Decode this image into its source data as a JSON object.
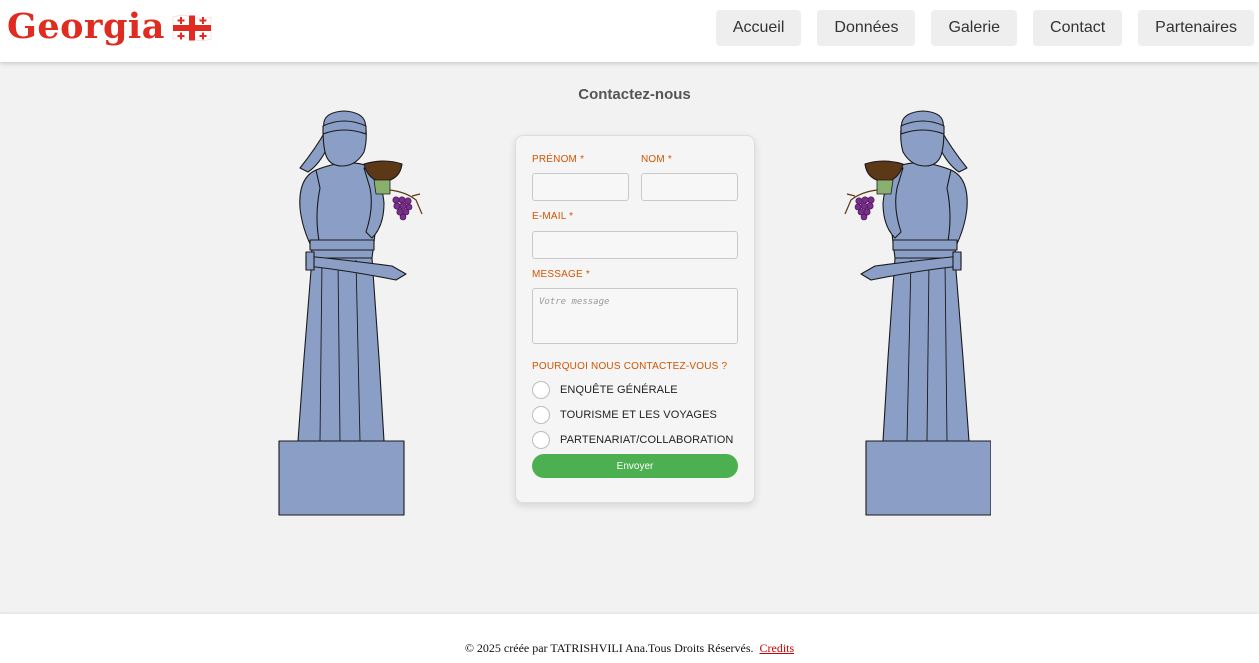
{
  "header": {
    "logo_text": "Georgia",
    "nav": [
      "Accueil",
      "Données",
      "Galerie",
      "Contact",
      "Partenaires"
    ]
  },
  "page": {
    "title": "Contactez-nous"
  },
  "form": {
    "first_name_label": "PRÉNOM *",
    "last_name_label": "NOM *",
    "email_label": "E-MAIL *",
    "message_label": "MESSAGE *",
    "message_placeholder": "Votre message",
    "reason_label": "POURQUOI NOUS CONTACTEZ-VOUS ?",
    "reasons": [
      "ENQUÊTE GÉNÉRALE",
      "TOURISME ET LES VOYAGES",
      "PARTENARIAT/COLLABORATION"
    ],
    "submit_label": "Envoyer"
  },
  "footer": {
    "copyright": "© 2025 créée par TATRISHVILI Ana.Tous Droits Réservés.",
    "credits_link": "Credits"
  },
  "colors": {
    "brand_red": "#e02b20",
    "label_orange": "#d35400",
    "submit_green": "#4caf50",
    "statue_blue": "#8a9ec6"
  }
}
